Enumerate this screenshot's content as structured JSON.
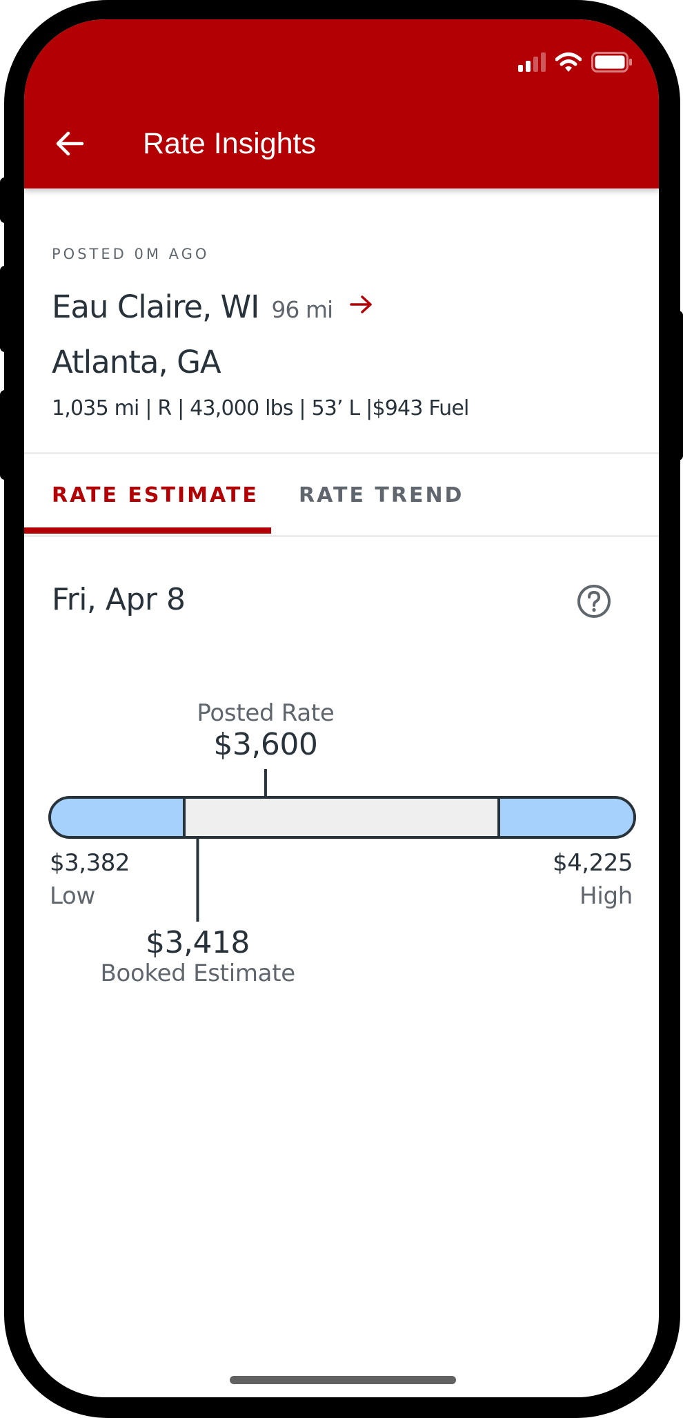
{
  "status_bar": {
    "signal_icon": "cellular-signal-icon",
    "wifi_icon": "wifi-icon",
    "battery_icon": "battery-icon"
  },
  "header": {
    "back_icon": "arrow-left-icon",
    "title": "Rate Insights",
    "background_color": "#b20005"
  },
  "load": {
    "posted_label": "POSTED 0M AGO",
    "origin": "Eau Claire, WI",
    "deadhead": "96 mi",
    "direction_icon": "arrow-right-icon",
    "destination": "Atlanta, GA",
    "details": "1,035 mi | R | 43,000 lbs | 53’ L |$943 Fuel"
  },
  "tabs": [
    {
      "label": "RATE ESTIMATE",
      "active": true
    },
    {
      "label": "RATE TREND",
      "active": false
    }
  ],
  "rate_estimate": {
    "date": "Fri, Apr 8",
    "help_icon": "help-circle-icon",
    "posted_rate": {
      "label": "Posted Rate",
      "value_text": "$3,600",
      "value": 3600
    },
    "booked_estimate": {
      "label": "Booked Estimate",
      "value_text": "$3,418",
      "value": 3418
    },
    "low": {
      "label": "Low",
      "value_text": "$3,382",
      "value": 3382
    },
    "high": {
      "label": "High",
      "value_text": "$4,225",
      "value": 4225
    },
    "colors": {
      "range_fill": "#efefef",
      "cap_fill": "#a6d1fc",
      "outline": "#27323a"
    }
  }
}
